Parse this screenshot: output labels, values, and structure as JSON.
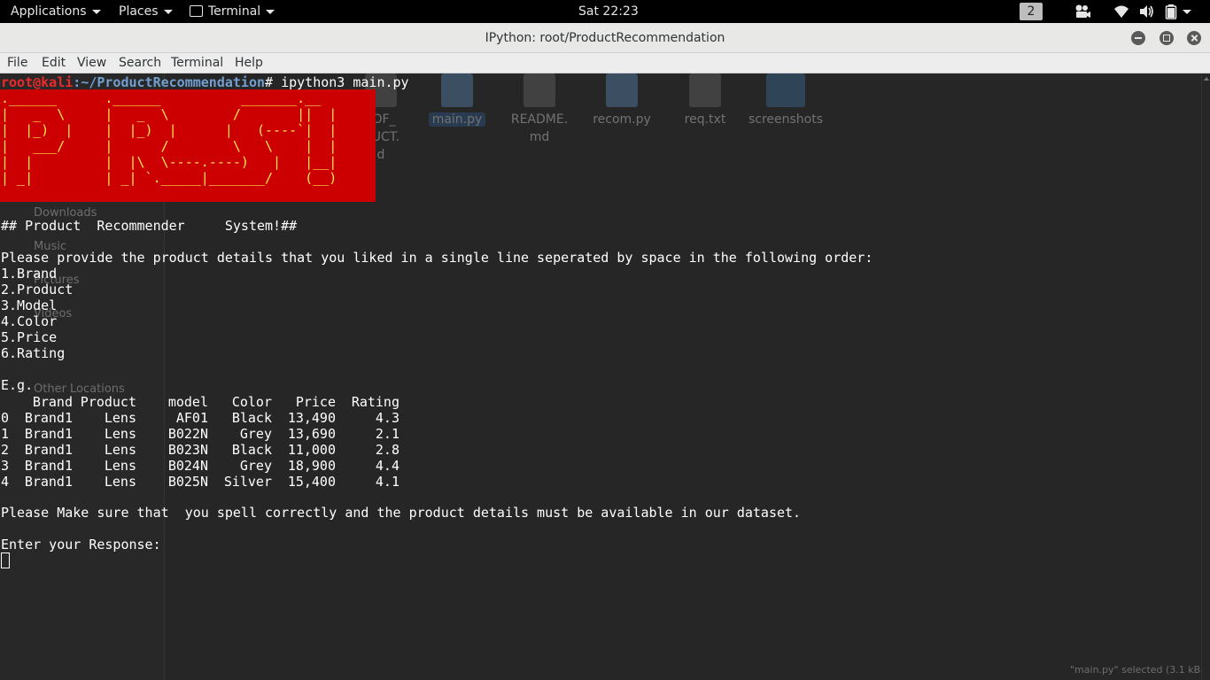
{
  "topbar": {
    "applications": "Applications",
    "places": "Places",
    "terminal": "Terminal",
    "clock": "Sat 22:23",
    "workspace": "2",
    "icons": [
      "camera-icon",
      "wifi-icon",
      "volume-icon",
      "battery-icon",
      "power-menu-icon"
    ]
  },
  "window": {
    "title": "IPython: root/ProductRecommendation"
  },
  "menu": [
    "File",
    "Edit",
    "View",
    "Search",
    "Terminal",
    "Help"
  ],
  "terminal": {
    "prompt_user": "root@kali",
    "prompt_path": ":~/ProductRecommendation",
    "prompt_cmd": "# ipython3 main.py",
    "banner": [
      ".______      .______          _______.__",
      "|   _  \\     |   _  \\        /       ||  |",
      "|  |_)  |    |  |_)  |      |   (----`|  |",
      "|   ___/     |      /        \\   \\    |  |",
      "|  |         |  |\\  \\----.----)   |   |__|",
      "| _|         | _| `._____|_______/    (__)"
    ],
    "heading": "## Product  Recommender     System!##",
    "instruction": "Please provide the product details that you liked in a single line seperated by space in the following order:",
    "fields": [
      "1.Brand",
      "2.Product",
      "3.Model",
      "4.Color",
      "5.Price",
      "6.Rating"
    ],
    "example_label": "E.g.",
    "table": {
      "headers": [
        "Brand",
        "Product",
        "model",
        "Color",
        "Price",
        "Rating"
      ],
      "rows": [
        [
          "0",
          "Brand1",
          "Lens",
          "AF01",
          "Black",
          "13,490",
          "4.3"
        ],
        [
          "1",
          "Brand1",
          "Lens",
          "B022N",
          "Grey",
          "13,690",
          "2.1"
        ],
        [
          "2",
          "Brand1",
          "Lens",
          "B023N",
          "Black",
          "11,000",
          "2.8"
        ],
        [
          "3",
          "Brand1",
          "Lens",
          "B024N",
          "Grey",
          "18,900",
          "4.4"
        ],
        [
          "4",
          "Brand1",
          "Lens",
          "B025N",
          "Silver",
          "15,400",
          "4.1"
        ]
      ]
    },
    "warning": "Please Make sure that  you spell correctly and the product details must be available in our dataset.",
    "response_prompt": "Enter your Response:"
  },
  "background_file_manager": {
    "sidebar": [
      "Downloads",
      "Music",
      "Pictures",
      "Videos",
      "Other Locations"
    ],
    "files": [
      {
        "name": "_OF_\nDUCT.\nd",
        "icon": "doc"
      },
      {
        "name": "main.py",
        "icon": "py",
        "selected": true
      },
      {
        "name": "README.\nmd",
        "icon": "doc"
      },
      {
        "name": "recom.py",
        "icon": "py"
      },
      {
        "name": "req.txt",
        "icon": "doc"
      },
      {
        "name": "screenshots",
        "icon": "folder"
      }
    ],
    "status": "\"main.py\" selected  (3.1 kB)"
  }
}
